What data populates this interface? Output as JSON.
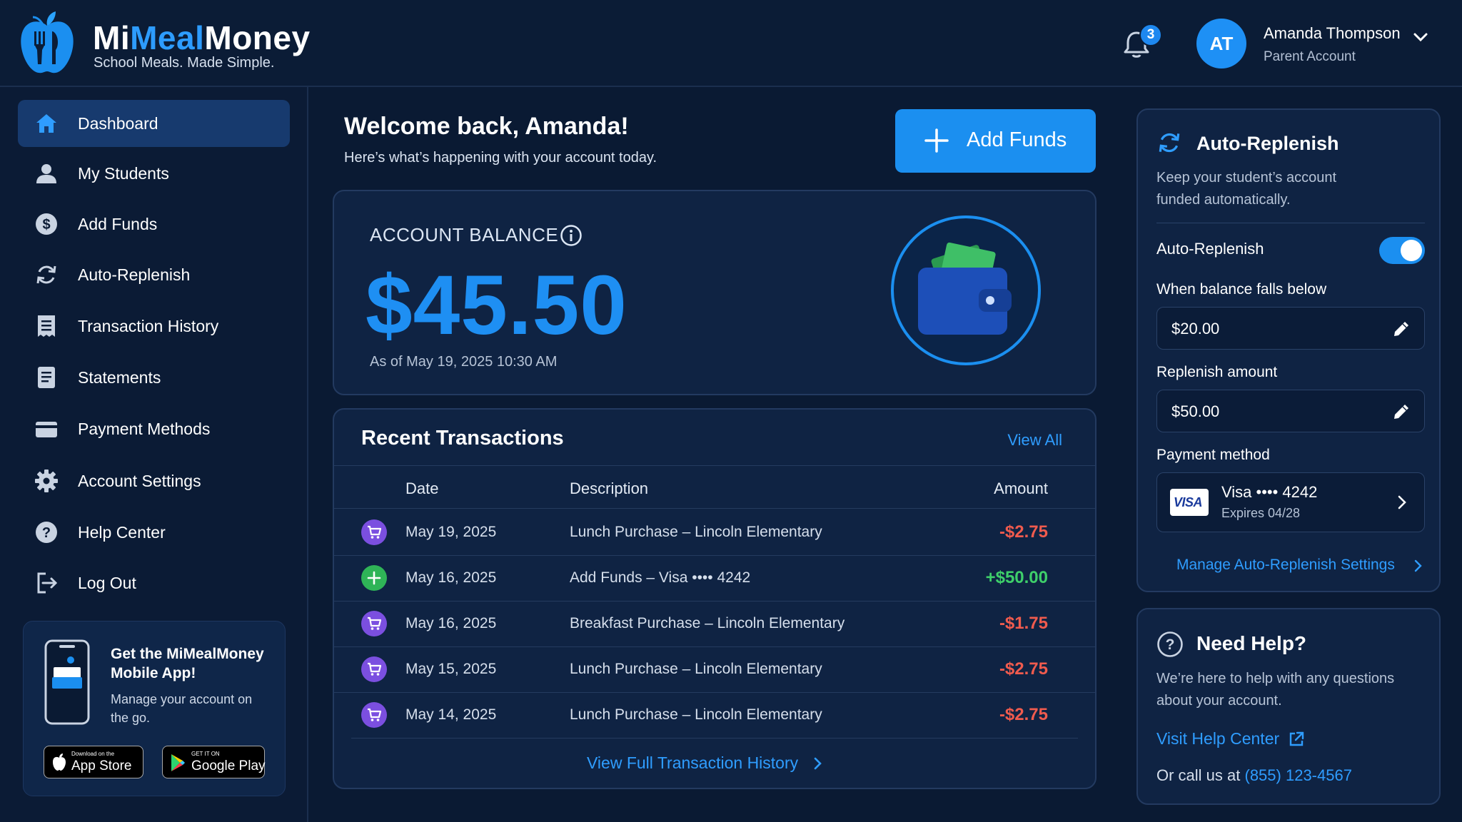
{
  "header": {
    "brand_left": "Mi",
    "brand_mid": "Meal",
    "brand_right": "Money",
    "tagline": "School Meals. Made Simple.",
    "notification_count": "3",
    "user": {
      "initials": "AT",
      "name": "Amanda Thompson",
      "role": "Parent Account"
    }
  },
  "sidebar": {
    "items": [
      {
        "label": "Dashboard",
        "icon": "home-icon",
        "active": true
      },
      {
        "label": "My Students",
        "icon": "user-icon"
      },
      {
        "label": "Add Funds",
        "icon": "dollar-icon"
      },
      {
        "label": "Auto-Replenish",
        "icon": "refresh-icon"
      },
      {
        "label": "Transaction History",
        "icon": "receipt-icon"
      },
      {
        "label": "Statements",
        "icon": "document-icon"
      },
      {
        "label": "Payment Methods",
        "icon": "credit-card-icon"
      },
      {
        "label": "Account Settings",
        "icon": "gear-icon"
      },
      {
        "label": "Help Center",
        "icon": "question-icon"
      },
      {
        "label": "Log Out",
        "icon": "logout-icon"
      }
    ],
    "app_promo": {
      "title": "Get the MiMealMoney Mobile App!",
      "subtitle": "Manage your account on the go.",
      "app_store_small": "Download on the",
      "app_store_big": "App Store",
      "google_play_small": "GET IT ON",
      "google_play_big": "Google Play"
    }
  },
  "main": {
    "welcome_title": "Welcome back, Amanda!",
    "welcome_sub": "Here’s what’s happening with your account today.",
    "add_funds_label": "Add Funds",
    "balance": {
      "label": "ACCOUNT BALANCE",
      "amount": "$45.50",
      "as_of": "As of May 19, 2025 10:30 AM"
    },
    "transactions": {
      "title": "Recent Transactions",
      "view_all": "View All",
      "columns": [
        "Date",
        "Description",
        "Amount"
      ],
      "rows": [
        {
          "date": "May 19, 2025",
          "description": "Lunch Purchase – Lincoln Elementary",
          "amount": "-$2.75",
          "type": "purchase"
        },
        {
          "date": "May 16, 2025",
          "description": "Add Funds – Visa •••• 4242",
          "amount": "+$50.00",
          "type": "deposit"
        },
        {
          "date": "May 16, 2025",
          "description": "Breakfast Purchase – Lincoln Elementary",
          "amount": "-$1.75",
          "type": "purchase"
        },
        {
          "date": "May 15, 2025",
          "description": "Lunch Purchase – Lincoln Elementary",
          "amount": "-$2.75",
          "type": "purchase"
        },
        {
          "date": "May 14, 2025",
          "description": "Lunch Purchase – Lincoln Elementary",
          "amount": "-$2.75",
          "type": "purchase"
        }
      ],
      "full_history": "View Full Transaction History"
    }
  },
  "auto_replenish": {
    "title": "Auto-Replenish",
    "description": "Keep your student’s account funded automatically.",
    "toggle_label": "Auto-Replenish",
    "enabled": true,
    "threshold_label": "When balance falls below",
    "threshold_value": "$20.00",
    "amount_label": "Replenish amount",
    "amount_value": "$50.00",
    "payment_label": "Payment method",
    "card_brand": "VISA",
    "card_main": "Visa •••• 4242",
    "card_expiry": "Expires 04/28",
    "manage_link": "Manage Auto-Replenish Settings"
  },
  "help": {
    "title": "Need Help?",
    "description": "We’re here to help with any questions about your account.",
    "link": "Visit Help Center",
    "call_prefix": "Or call us at",
    "phone": "(855) 123-4567"
  },
  "colors": {
    "background": "#0a1a33",
    "accent": "#1b8ff0",
    "negative": "#f05b4e",
    "positive": "#3ecf6a",
    "purchase_icon": "#7b4fe0"
  }
}
